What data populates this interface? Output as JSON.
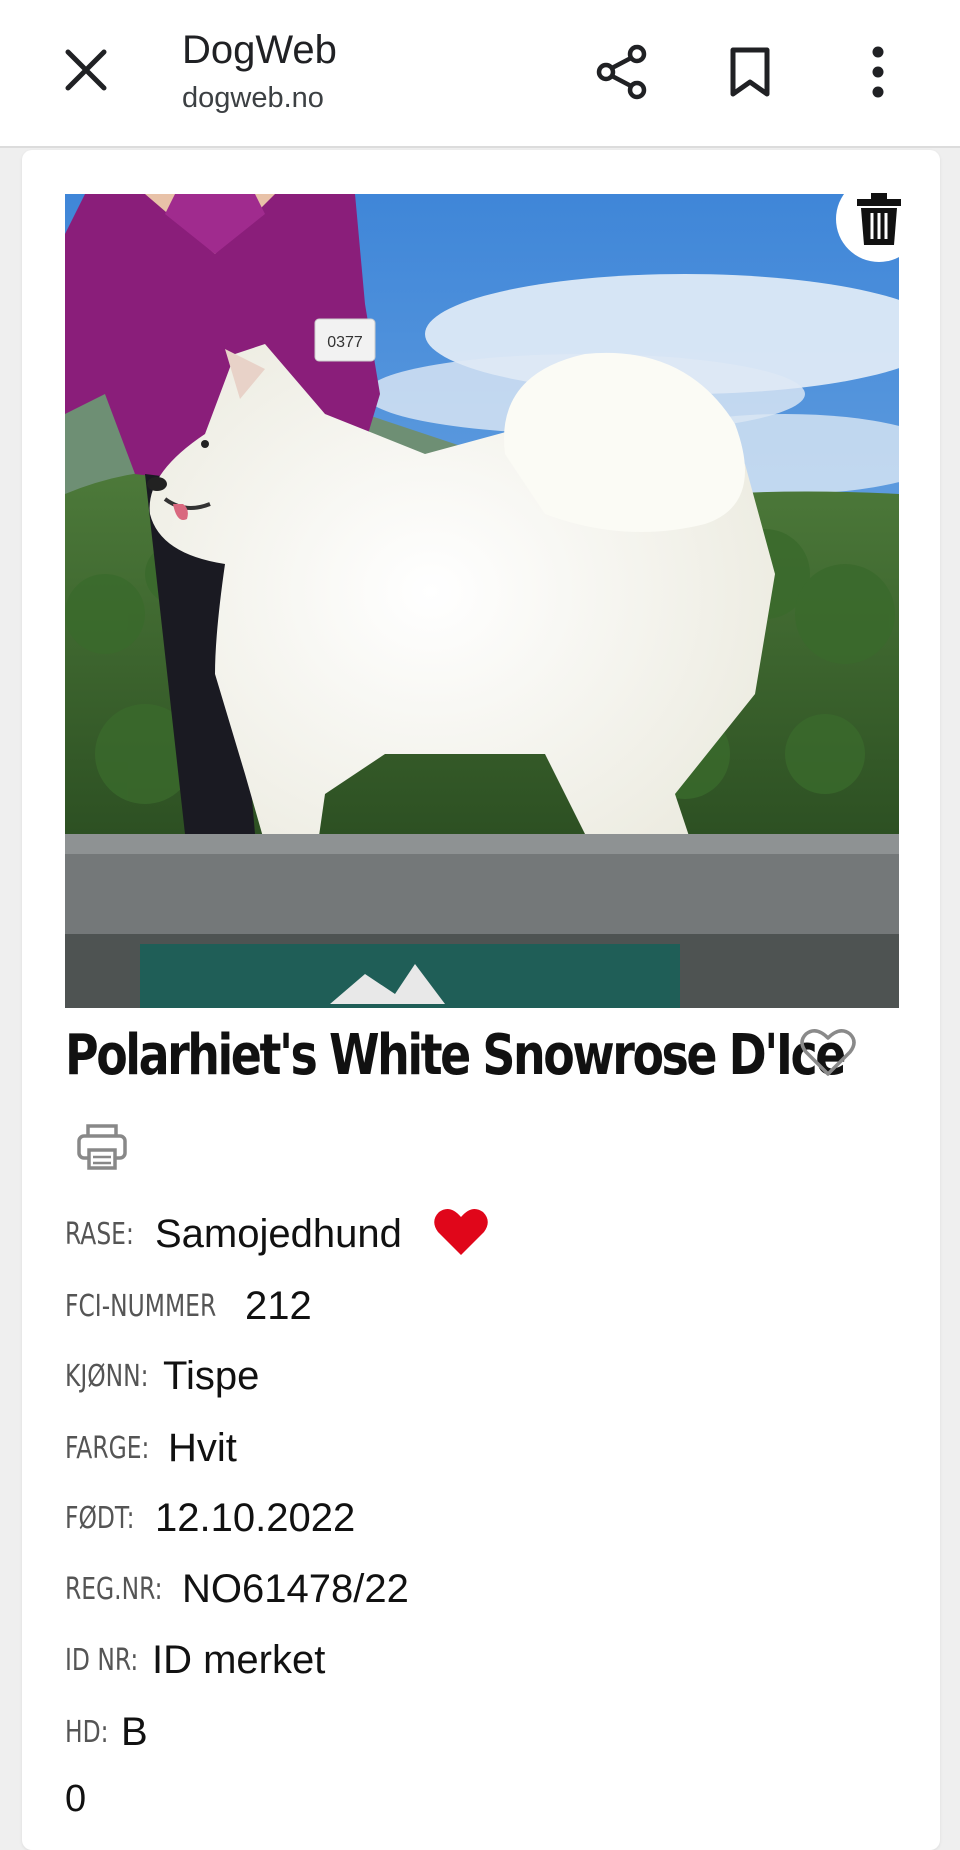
{
  "browser": {
    "site_title": "DogWeb",
    "site_url": "dogweb.no",
    "icons": {
      "close": "close-icon",
      "share": "share-icon",
      "bookmark": "bookmark-icon",
      "menu": "more-vertical-icon"
    }
  },
  "dog": {
    "name": "Polarhiet's White Snowrose D'Ice",
    "photo_number_tag": "0377",
    "fields": [
      {
        "label": "RASE:",
        "value": "Samojedhund"
      },
      {
        "label": "FCI-NUMMER",
        "value": "212"
      },
      {
        "label": "KJØNN:",
        "value": "Tispe"
      },
      {
        "label": "FARGE:",
        "value": "Hvit"
      },
      {
        "label": "FØDT:",
        "value": "12.10.2022"
      },
      {
        "label": "REG.NR:",
        "value": "NO61478/22"
      },
      {
        "label": "ID NR:",
        "value": "ID merket"
      },
      {
        "label": "HD:",
        "value": "B"
      }
    ],
    "extra_value": "0"
  },
  "colors": {
    "breed_heart": "#e0061a",
    "accent_text": "#111111"
  }
}
